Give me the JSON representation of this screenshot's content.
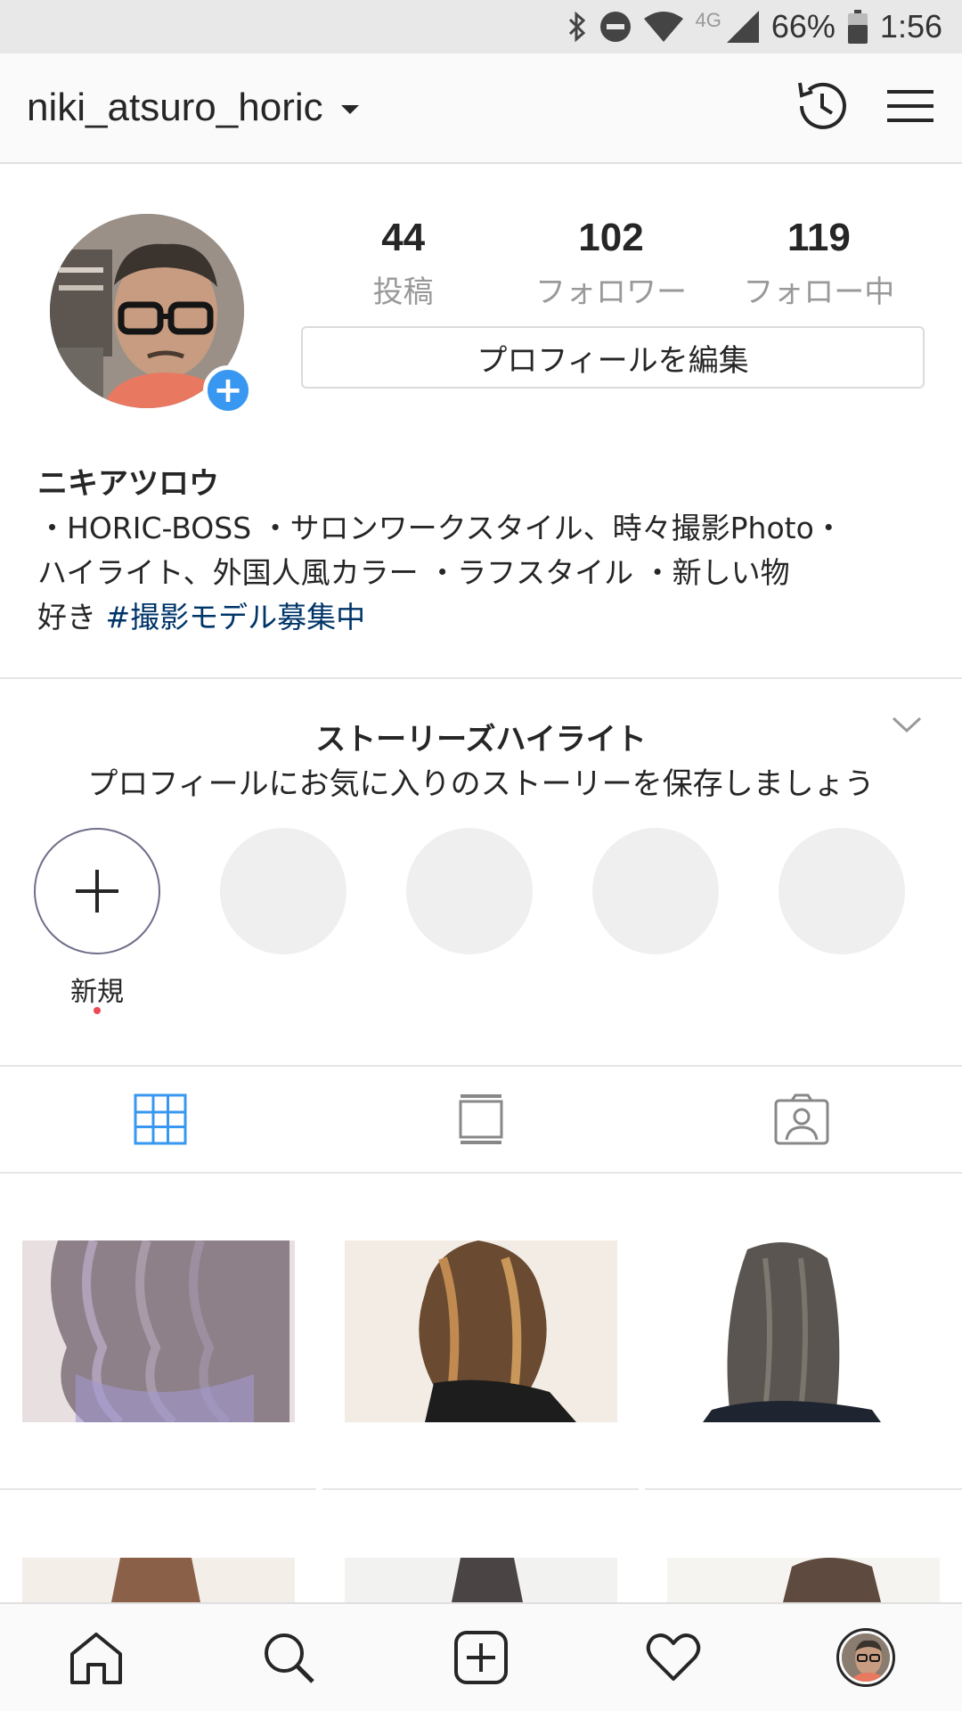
{
  "status_bar": {
    "network": "4G",
    "battery": "66%",
    "time": "1:56"
  },
  "header": {
    "username": "niki_atsuro_horic",
    "icons": [
      "chevron-down-icon",
      "archive-clock-icon",
      "hamburger-menu-icon"
    ]
  },
  "profile": {
    "stats": [
      {
        "value": "44",
        "label": "投稿"
      },
      {
        "value": "102",
        "label": "フォロワー"
      },
      {
        "value": "119",
        "label": "フォロー中"
      }
    ],
    "edit_button": "プロフィールを編集",
    "display_name": "ニキアツロウ",
    "bio_line1": "・HORIC-BOSS ・サロンワークスタイル、時々撮影Photo・",
    "bio_line2": "ハイライト、外国人風カラー ・ラフスタイル ・新しい物",
    "bio_line3_prefix": "好き ",
    "bio_hashtag": "#撮影モデル募集中",
    "hashtag_color": "#003569"
  },
  "highlights": {
    "title": "ストーリーズハイライト",
    "subtitle": "プロフィールにお気に入りのストーリーを保存しましょう",
    "new_label": "新規"
  },
  "tabs": [
    {
      "icon": "grid-icon",
      "active": true
    },
    {
      "icon": "feed-list-icon",
      "active": false
    },
    {
      "icon": "tagged-photos-icon",
      "active": false
    }
  ],
  "colors": {
    "accent": "#3897f0",
    "text": "#262626",
    "muted": "#999999",
    "notification_dot": "#ed4956"
  },
  "bottom_nav": [
    "home-icon",
    "search-icon",
    "new-post-icon",
    "activity-heart-icon",
    "profile-avatar"
  ]
}
